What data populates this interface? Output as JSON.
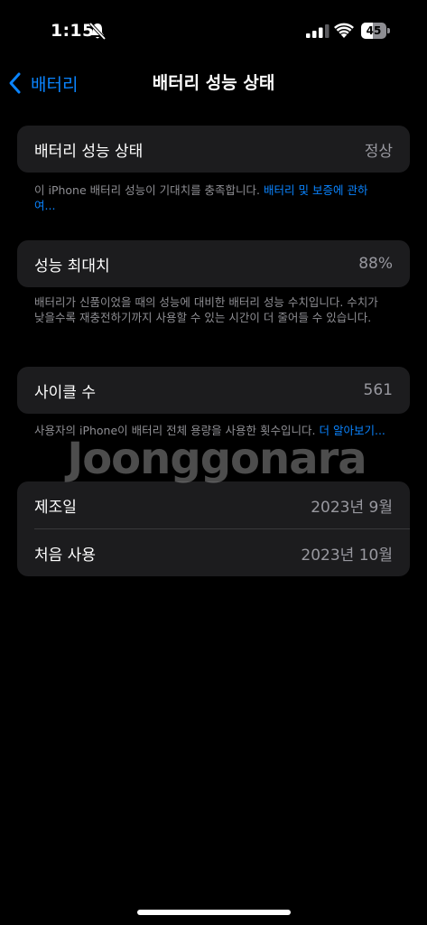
{
  "status_bar": {
    "time": "1:15",
    "battery_level": "45",
    "battery_fraction": 0.45
  },
  "nav": {
    "back_label": "배터리",
    "title": "배터리 성능 상태"
  },
  "health_status": {
    "label": "배터리 성능 상태",
    "value": "정상",
    "footnote": "이 iPhone 배터리 성능이 기대치를 충족합니다.",
    "link": "배터리 및 보증에 관하여..."
  },
  "max_capacity": {
    "label": "성능 최대치",
    "value": "88%",
    "footnote": "배터리가 신품이었을 때의 성능에 대비한 배터리 성능 수치입니다. 수치가 낮을수록 재충전하기까지 사용할 수 있는 시간이 더 줄어들 수 있습니다."
  },
  "cycle_count": {
    "label": "사이클 수",
    "value": "561",
    "footnote": "사용자의 iPhone이 배터리 전체 용량을 사용한 횟수입니다.",
    "link": "더 알아보기..."
  },
  "dates": {
    "manufacture_label": "제조일",
    "manufacture_value": "2023년 9월",
    "first_use_label": "처음 사용",
    "first_use_value": "2023년 10월"
  },
  "watermark": "Joonggonara",
  "colors": {
    "background": "#000000",
    "cell": "#1c1c1e",
    "accent": "#0a84ff",
    "secondary_text": "#98989f"
  }
}
